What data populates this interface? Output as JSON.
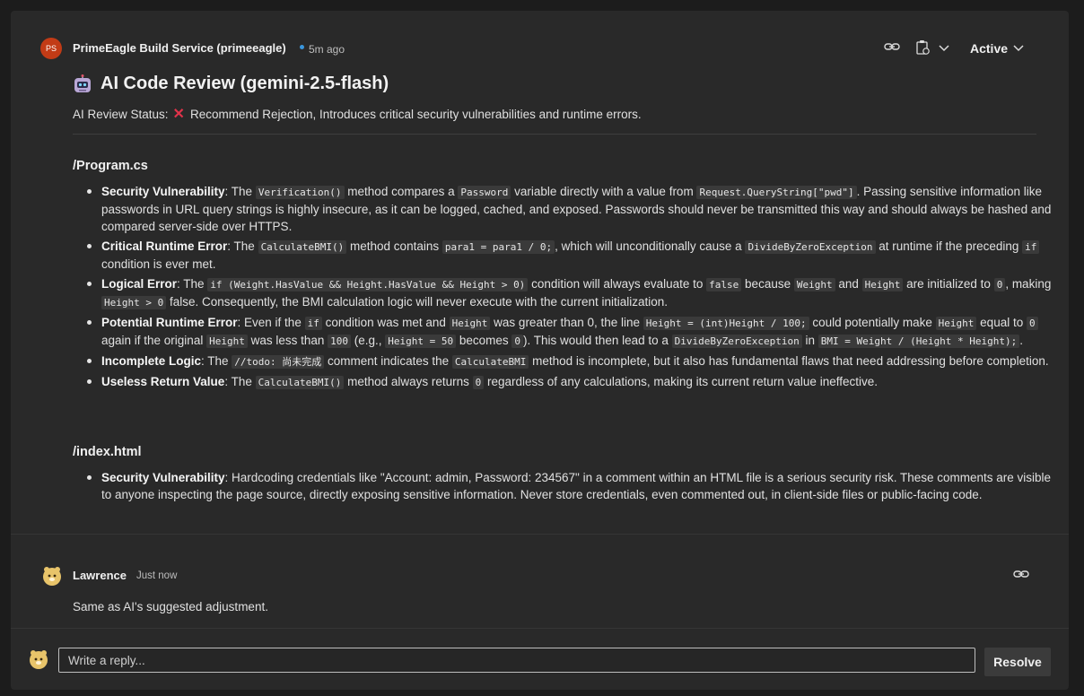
{
  "thread": {
    "author": "PrimeEagle Build Service (primeeagle)",
    "avatar_initials": "PS",
    "avatar_color": "#c23b16",
    "time": "5m ago",
    "status_dropdown": "Active",
    "title": "AI Code Review (gemini-2.5-flash)",
    "status_prefix": "AI Review Status:",
    "status_icon": "cross-mark-icon",
    "status_text": "Recommend Rejection, Introduces critical security vulnerabilities and runtime errors.",
    "sections": [
      {
        "file": "/Program.cs",
        "items": [
          {
            "label": "Security Vulnerability",
            "parts": [
              ": The ",
              "`Verification()",
              " method compares a ",
              "`Password",
              " variable directly with a value from ",
              "`Request.QueryString[\"pwd\"]",
              ". Passing sensitive information like passwords in URL query strings is highly insecure, as it can be logged, cached, and exposed. Passwords should never be transmitted this way and should always be hashed and compared server-side over HTTPS."
            ]
          },
          {
            "label": "Critical Runtime Error",
            "parts": [
              ": The ",
              "`CalculateBMI()",
              " method contains ",
              "`para1 = para1 / 0;",
              ", which will unconditionally cause a ",
              "`DivideByZeroException",
              " at runtime if the preceding ",
              "`if",
              " condition is ever met."
            ]
          },
          {
            "label": "Logical Error",
            "parts": [
              ": The ",
              "`if (Weight.HasValue && Height.HasValue && Height > 0)",
              " condition will always evaluate to ",
              "`false",
              " because ",
              "`Weight",
              " and ",
              "`Height",
              " are initialized to ",
              "`0",
              ", making ",
              "`Height > 0",
              " false. Consequently, the BMI calculation logic will never execute with the current initialization."
            ]
          },
          {
            "label": "Potential Runtime Error",
            "parts": [
              ": Even if the ",
              "`if",
              " condition was met and ",
              "`Height",
              " was greater than 0, the line ",
              "`Height = (int)Height / 100;",
              " could potentially make ",
              "`Height",
              " equal to ",
              "`0",
              " again if the original ",
              "`Height",
              " was less than ",
              "`100",
              " (e.g., ",
              "`Height = 50",
              " becomes ",
              "`0",
              "). This would then lead to a ",
              "`DivideByZeroException",
              " in ",
              "`BMI = Weight / (Height * Height);",
              "."
            ]
          },
          {
            "label": "Incomplete Logic",
            "parts": [
              ": The ",
              "`//todo: 尚未完成",
              " comment indicates the ",
              "`CalculateBMI",
              " method is incomplete, but it also has fundamental flaws that need addressing before completion."
            ]
          },
          {
            "label": "Useless Return Value",
            "parts": [
              ": The ",
              "`CalculateBMI()",
              " method always returns ",
              "`0",
              " regardless of any calculations, making its current return value ineffective."
            ]
          }
        ]
      },
      {
        "file": "/index.html",
        "items": [
          {
            "label": "Security Vulnerability",
            "parts": [
              ": Hardcoding credentials like \"Account: admin, Password: 234567\" in a comment within an HTML file is a serious security risk. These comments are visible to anyone inspecting the page source, directly exposing sensitive information. Never store credentials, even commented out, in client-side files or public-facing code."
            ]
          }
        ]
      }
    ]
  },
  "reply_comment": {
    "author": "Lawrence",
    "time": "Just now",
    "text": "Same as AI's suggested adjustment."
  },
  "composer": {
    "placeholder": "Write a reply...",
    "resolve_label": "Resolve"
  }
}
